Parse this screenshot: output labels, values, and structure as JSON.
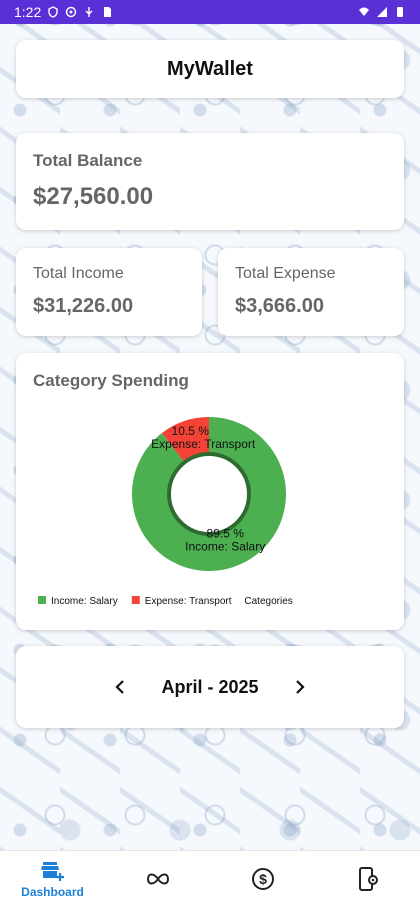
{
  "status_bar": {
    "time": "1:22"
  },
  "header": {
    "title": "MyWallet"
  },
  "balance": {
    "label": "Total Balance",
    "value": "$27,560.00"
  },
  "income": {
    "label": "Total Income",
    "value": "$31,226.00"
  },
  "expense": {
    "label": "Total Expense",
    "value": "$3,666.00"
  },
  "category": {
    "title": "Category Spending"
  },
  "chart_data": {
    "type": "pie",
    "donut": true,
    "slices": [
      {
        "label": "Income: Salary",
        "value": 89.5,
        "percent_label": "89.5 %",
        "color": "#4caf50"
      },
      {
        "label": "Expense: Transport",
        "value": 10.5,
        "percent_label": "10.5 %",
        "color": "#f44336"
      }
    ],
    "legend": {
      "items": [
        "Income: Salary",
        "Expense: Transport"
      ],
      "suffix": "Categories",
      "placement": "bottom-left"
    },
    "hole_color": "#ffffff",
    "hole_ring_color": "#2e6b30"
  },
  "date_nav": {
    "label": "April - 2025",
    "prev": "‹",
    "next": "›"
  },
  "bottom_nav": {
    "items": [
      {
        "label": "Dashboard",
        "icon": "store-add-icon",
        "active": true
      },
      {
        "label": "",
        "icon": "infinity-icon",
        "active": false
      },
      {
        "label": "",
        "icon": "dollar-circle-icon",
        "active": false
      },
      {
        "label": "",
        "icon": "phone-settings-icon",
        "active": false
      }
    ],
    "active_color": "#1e7fd9",
    "inactive_color": "#222222"
  },
  "colors": {
    "status_bar": "#5a2fd6"
  }
}
